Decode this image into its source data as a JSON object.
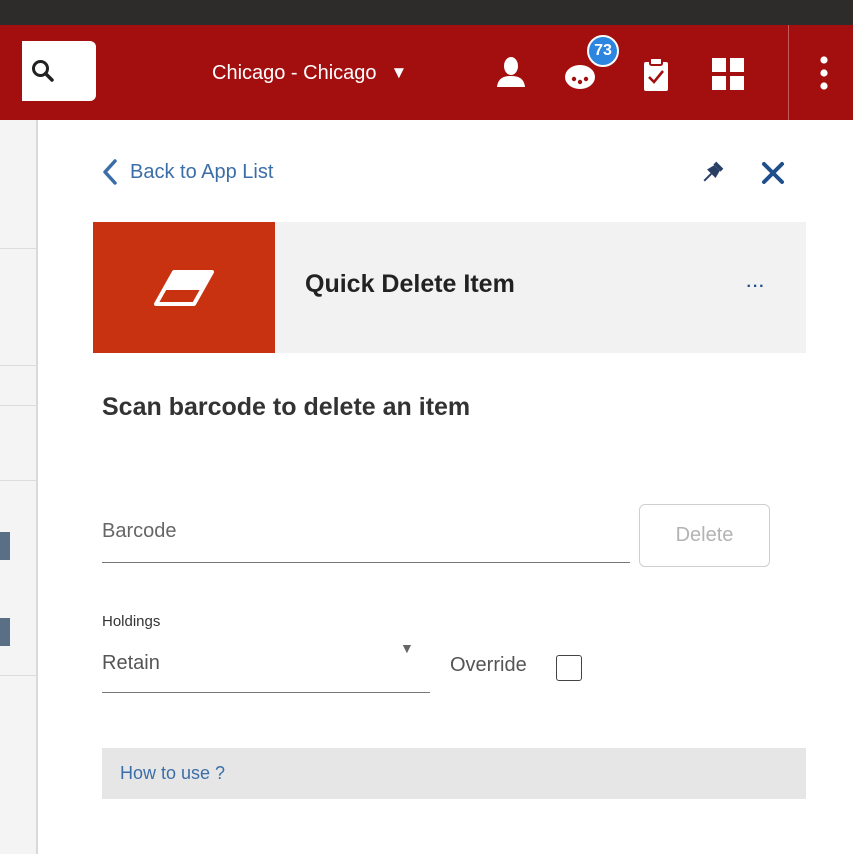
{
  "header": {
    "location": "Chicago - Chicago",
    "notification_count": "73",
    "icons": [
      "search-icon",
      "user-icon",
      "notifications-icon",
      "tasks-icon",
      "layout-icon",
      "more-vertical-icon"
    ],
    "background_color": "#a30f0f"
  },
  "panel": {
    "back_label": "Back to App List",
    "pin_icon": "pin-icon",
    "close_icon": "close-icon"
  },
  "app": {
    "title": "Quick Delete Item",
    "icon": "eraser-icon",
    "icon_background": "#c93210",
    "more_label": "···"
  },
  "form": {
    "heading": "Scan barcode to delete an item",
    "barcode_placeholder": "Barcode",
    "delete_label": "Delete",
    "holdings_label": "Holdings",
    "holdings_value": "Retain",
    "override_label": "Override",
    "override_checked": false
  },
  "help": {
    "label": "How to use ?"
  }
}
